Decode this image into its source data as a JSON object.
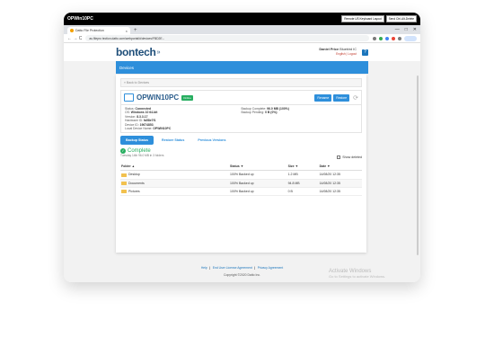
{
  "remote": {
    "title": "OPWin10PC",
    "buttons": [
      "Remote US Keyboard Layout",
      "Send Ctrl-Alt-Delete"
    ]
  },
  "browser": {
    "tab_title": "Datto File Protection",
    "new_tab": "+",
    "window_controls": [
      "—",
      "□",
      "✕"
    ],
    "nav": "← → C",
    "url": "au.filepro tection.datto.com/webportal/#/devices/FBD2E..."
  },
  "header": {
    "logo_text": "bontech",
    "logo_mark": "»",
    "user": "Daniel Price",
    "company": "Bluebird IC",
    "language": "English",
    "logout": "Logout",
    "help": "?"
  },
  "nav": {
    "devices": "Devices"
  },
  "back_link": "« Back to Devices",
  "device": {
    "name": "OPWIN10PC",
    "status_badge": "Online",
    "actions": [
      "Rename",
      "Restore"
    ],
    "refresh": "⟳",
    "details_left": [
      {
        "label": "Status:",
        "value": "Connected"
      },
      {
        "label": "OS:",
        "value": "Windows 10 64-bit"
      },
      {
        "label": "Version:",
        "value": "8.3.3.17"
      },
      {
        "label": "Hardware ID:",
        "value": "fa58e7f1"
      },
      {
        "label": "Device ID:",
        "value": "19674853"
      },
      {
        "label": "Local Device Name:",
        "value": "OPWIN10PC"
      }
    ],
    "details_right": [
      {
        "label": "Backup Complete:",
        "value": "96.0 MB (100%)"
      },
      {
        "label": "Backup Pending:",
        "value": "0 B (0%)"
      }
    ]
  },
  "subtabs": [
    "Backup Status",
    "Restore Status",
    "Previous Versions"
  ],
  "backup": {
    "status": "Complete",
    "check": "✓",
    "note": "Tuesday 14th 96.0 MB in 3 folders",
    "show_deleted": "Show deleted"
  },
  "table": {
    "headers": [
      "Folder ▲",
      "Status ▼",
      "Size ▼",
      "Date ▼"
    ],
    "rows": [
      [
        "Desktop",
        "100% Backed up",
        "1.2 MB",
        "14/08/20 12:35"
      ],
      [
        "Documents",
        "100% Backed up",
        "94.8 MB",
        "14/08/20 12:35"
      ],
      [
        "Pictures",
        "100% Backed up",
        "0 B",
        "14/08/20 12:35"
      ]
    ]
  },
  "footer": {
    "links": [
      "Help",
      "End User License Agreement",
      "Privacy Agreement"
    ],
    "separator": "|",
    "copyright": "Copyright ©2020 Datto Inc."
  },
  "watermark": {
    "title": "Activate Windows",
    "subtitle": "Go to Settings to activate Windows."
  }
}
